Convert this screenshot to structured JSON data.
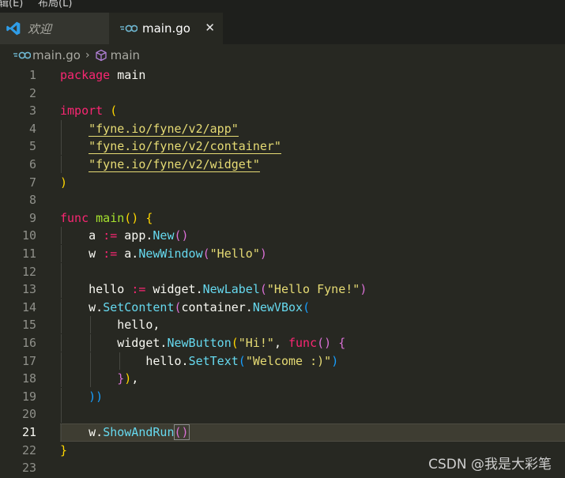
{
  "menu": {
    "left_text": "辑(E)",
    "right_text": "布局(L)"
  },
  "tabs": [
    {
      "label": "欢迎",
      "icon": "vscode-icon",
      "active": false
    },
    {
      "label": "main.go",
      "icon": "go-file-icon",
      "active": true,
      "close_glyph": "✕"
    }
  ],
  "breadcrumb": {
    "file": "main.go",
    "separator": "›",
    "symbol": "main"
  },
  "editor": {
    "line_numbers": [
      "1",
      "2",
      "3",
      "4",
      "5",
      "6",
      "7",
      "8",
      "9",
      "10",
      "11",
      "12",
      "13",
      "14",
      "15",
      "16",
      "17",
      "18",
      "19",
      "20",
      "21",
      "22",
      "23"
    ],
    "active_line": "21",
    "code": {
      "l1": [
        "package",
        "main"
      ],
      "l3": [
        "import",
        "("
      ],
      "l4": "\"fyne.io/fyne/v2/app\"",
      "l5": "\"fyne.io/fyne/v2/container\"",
      "l6": "\"fyne.io/fyne/v2/widget\"",
      "l7": ")",
      "l9": [
        "func",
        "main",
        "()",
        "{"
      ],
      "l10": [
        "a",
        ":=",
        "app.",
        "New",
        "()"
      ],
      "l11": [
        "w",
        ":=",
        "a.",
        "NewWindow",
        "(",
        "\"Hello\"",
        ")"
      ],
      "l13": [
        "hello",
        ":=",
        "widget.",
        "NewLabel",
        "(",
        "\"Hello Fyne!\"",
        ")"
      ],
      "l14": [
        "w.",
        "SetContent",
        "(",
        "container.",
        "NewVBox",
        "("
      ],
      "l15": "hello,",
      "l16": [
        "widget.",
        "NewButton",
        "(",
        "\"Hi!\"",
        ",",
        "func",
        "()",
        "{"
      ],
      "l17": [
        "hello.",
        "SetText",
        "(",
        "\"Welcome :)\"",
        ")"
      ],
      "l18": [
        "}",
        ")",
        ","
      ],
      "l19": [
        "))"
      ],
      "l21": [
        "w.",
        "ShowAndRun",
        "()"
      ],
      "l22": "}"
    }
  },
  "watermark": "CSDN @我是大彩笔",
  "colors": {
    "background": "#272822",
    "keyword": "#f92672",
    "function": "#a6e22e",
    "string": "#e6db74",
    "call": "#66d9ef"
  }
}
